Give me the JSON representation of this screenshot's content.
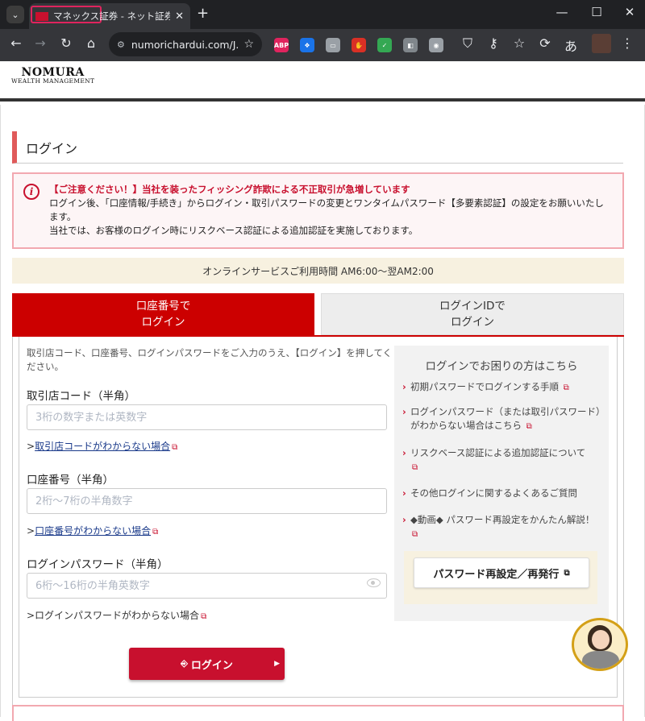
{
  "browser": {
    "tab_title": "マネックス証券 - ネット証券（オンライン",
    "tab_close": "✕",
    "new_tab": "+",
    "url": "numorichardui.com/J...",
    "window": {
      "minimize": "—",
      "maximize": "☐",
      "close": "✕"
    },
    "extensions": [
      {
        "name": "adblock-plus-icon",
        "label": "ABP",
        "color": "#e0245e"
      },
      {
        "name": "extension-blue-icon",
        "label": "❖",
        "color": "#1a73e8"
      },
      {
        "name": "extension-chat-icon",
        "label": "▭",
        "color": "#9aa0a6"
      },
      {
        "name": "extension-hand-icon",
        "label": "✋",
        "color": "#d93025"
      },
      {
        "name": "shield-icon",
        "label": "✓",
        "color": "#34a853"
      },
      {
        "name": "extension-grey-icon",
        "label": "◧",
        "color": "#80868b"
      },
      {
        "name": "camera-icon",
        "label": "◉",
        "color": "#9aa0a6"
      },
      {
        "name": "puzzle-icon",
        "label": "⌘",
        "color": "#5f6368"
      }
    ]
  },
  "site": {
    "logo_main": "NOMURA",
    "logo_sub": "WEALTH MANAGEMENT"
  },
  "page": {
    "title": "ログイン",
    "alert": {
      "heading": "【ご注意ください！】当社を装ったフィッシング詐欺による不正取引が急増しています",
      "line1": "ログイン後、「口座情報/手続き」からログイン・取引パスワードの変更とワンタイムパスワード【多要素認証】の設定をお願いいたします。",
      "line2": "当社では、お客様のログイン時にリスクベース認証による追加認証を実施しております。"
    },
    "hours": "オンラインサービスご利用時間 AM6:00〜翌AM2:00",
    "tabs": {
      "account_line1": "口座番号で",
      "account_line2": "ログイン",
      "loginid_line1": "ログインIDで",
      "loginid_line2": "ログイン"
    },
    "form": {
      "instructions": "取引店コード、口座番号、ログインパスワードをご入力のうえ、【ログイン】を押してください。",
      "branch_label": "取引店コード（半角）",
      "branch_placeholder": "3桁の数字または英数字",
      "branch_help_prefix": ">",
      "branch_help": "取引店コードがわからない場合",
      "account_label": "口座番号（半角）",
      "account_placeholder": "2桁〜7桁の半角数字",
      "account_help_prefix": ">",
      "account_help": "口座番号がわからない場合",
      "password_label": "ログインパスワード（半角）",
      "password_placeholder": "6桁〜16桁の半角英数字",
      "password_help": ">ログインパスワードがわからない場合",
      "login_button": "ログイン"
    },
    "side": {
      "title": "ログインでお困りの方はこちら",
      "items": [
        "初期パスワードでログインする手順",
        "ログインパスワード（または取引パスワード）がわからない場合はこちら",
        "リスクベース認証による追加認証について",
        "その他ログインに関するよくあるご質問",
        "◆動画◆ パスワード再設定をかんたん解説！"
      ],
      "reset_button": "パスワード再設定／再発行"
    }
  }
}
